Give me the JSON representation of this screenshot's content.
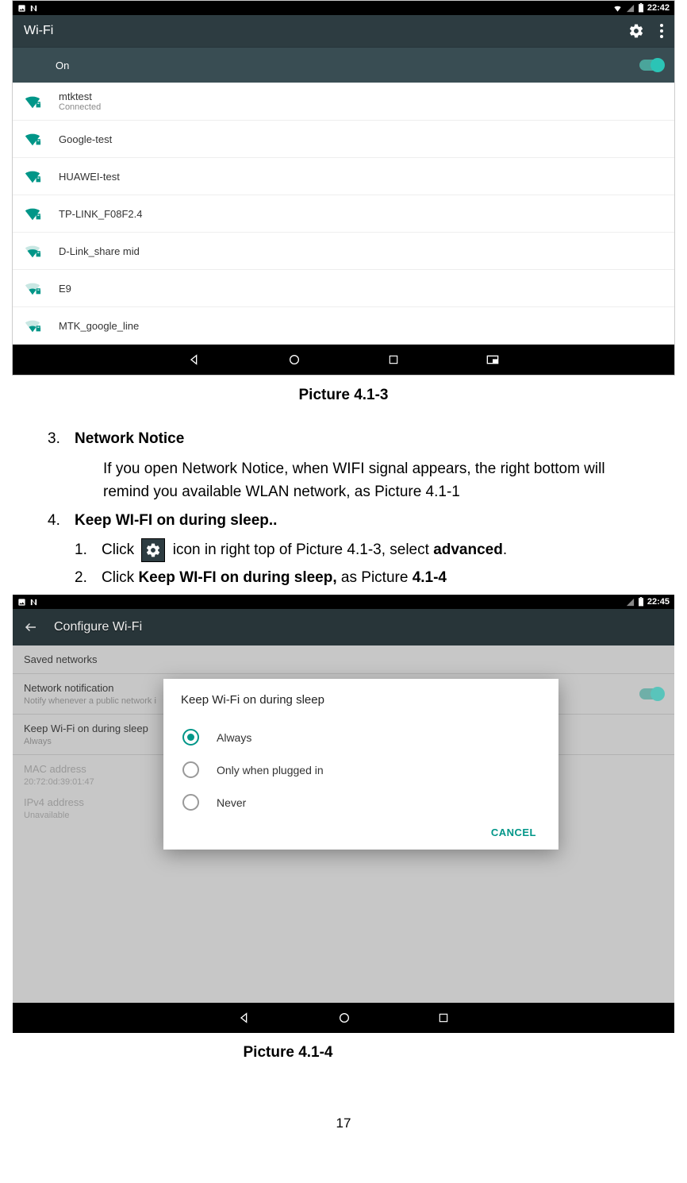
{
  "screenshot1": {
    "statusbar": {
      "time": "22:42"
    },
    "appbar": {
      "title": "Wi-Fi"
    },
    "subbar": {
      "label": "On"
    },
    "wifi_rows": [
      {
        "ssid": "mtktest",
        "sub": "Connected",
        "strength": "strong"
      },
      {
        "ssid": "Google-test",
        "sub": "",
        "strength": "strong"
      },
      {
        "ssid": "HUAWEI-test",
        "sub": "",
        "strength": "strong"
      },
      {
        "ssid": "TP-LINK_F08F2.4",
        "sub": "",
        "strength": "strong"
      },
      {
        "ssid": "D-Link_share mid",
        "sub": "",
        "strength": "mid"
      },
      {
        "ssid": "E9",
        "sub": "",
        "strength": "low"
      },
      {
        "ssid": "MTK_google_line",
        "sub": "",
        "strength": "low"
      }
    ]
  },
  "captions": {
    "pic1": "Picture 4.1-3",
    "pic2": "Picture 4.1-4"
  },
  "text": {
    "item3_num": "3.",
    "item3_title": "Network Notice",
    "item3_para": "If you open Network Notice, when WIFI signal appears, the right bottom will remind you available WLAN network, as Picture 4.1-1",
    "item4_num": "4.",
    "item4_title": "Keep WI-FI on during sleep..",
    "sub1_num": "1.",
    "sub1_a": "Click ",
    "sub1_b": " icon in right top of Picture 4.1-3, select ",
    "sub1_c": "advanced",
    "sub1_d": ".",
    "sub2_num": "2.",
    "sub2_a": "Click ",
    "sub2_b": "Keep WI-FI on during sleep,",
    "sub2_c": " as Picture ",
    "sub2_d": "4.1-4"
  },
  "screenshot2": {
    "statusbar": {
      "time": "22:45"
    },
    "appbar": {
      "title": "Configure Wi-Fi"
    },
    "rows": {
      "saved": "Saved networks",
      "notif_title": "Network notification",
      "notif_sub": "Notify whenever a public network i",
      "keep_title": "Keep Wi-Fi on during sleep",
      "keep_sub": "Always",
      "mac_title": "MAC address",
      "mac_sub": "20:72:0d:39:01:47",
      "ip_title": "IPv4 address",
      "ip_sub": "Unavailable"
    },
    "dialog": {
      "title": "Keep Wi-Fi on during sleep",
      "opt1": "Always",
      "opt2": "Only when plugged in",
      "opt3": "Never",
      "cancel": "CANCEL"
    }
  },
  "page_number": "17"
}
